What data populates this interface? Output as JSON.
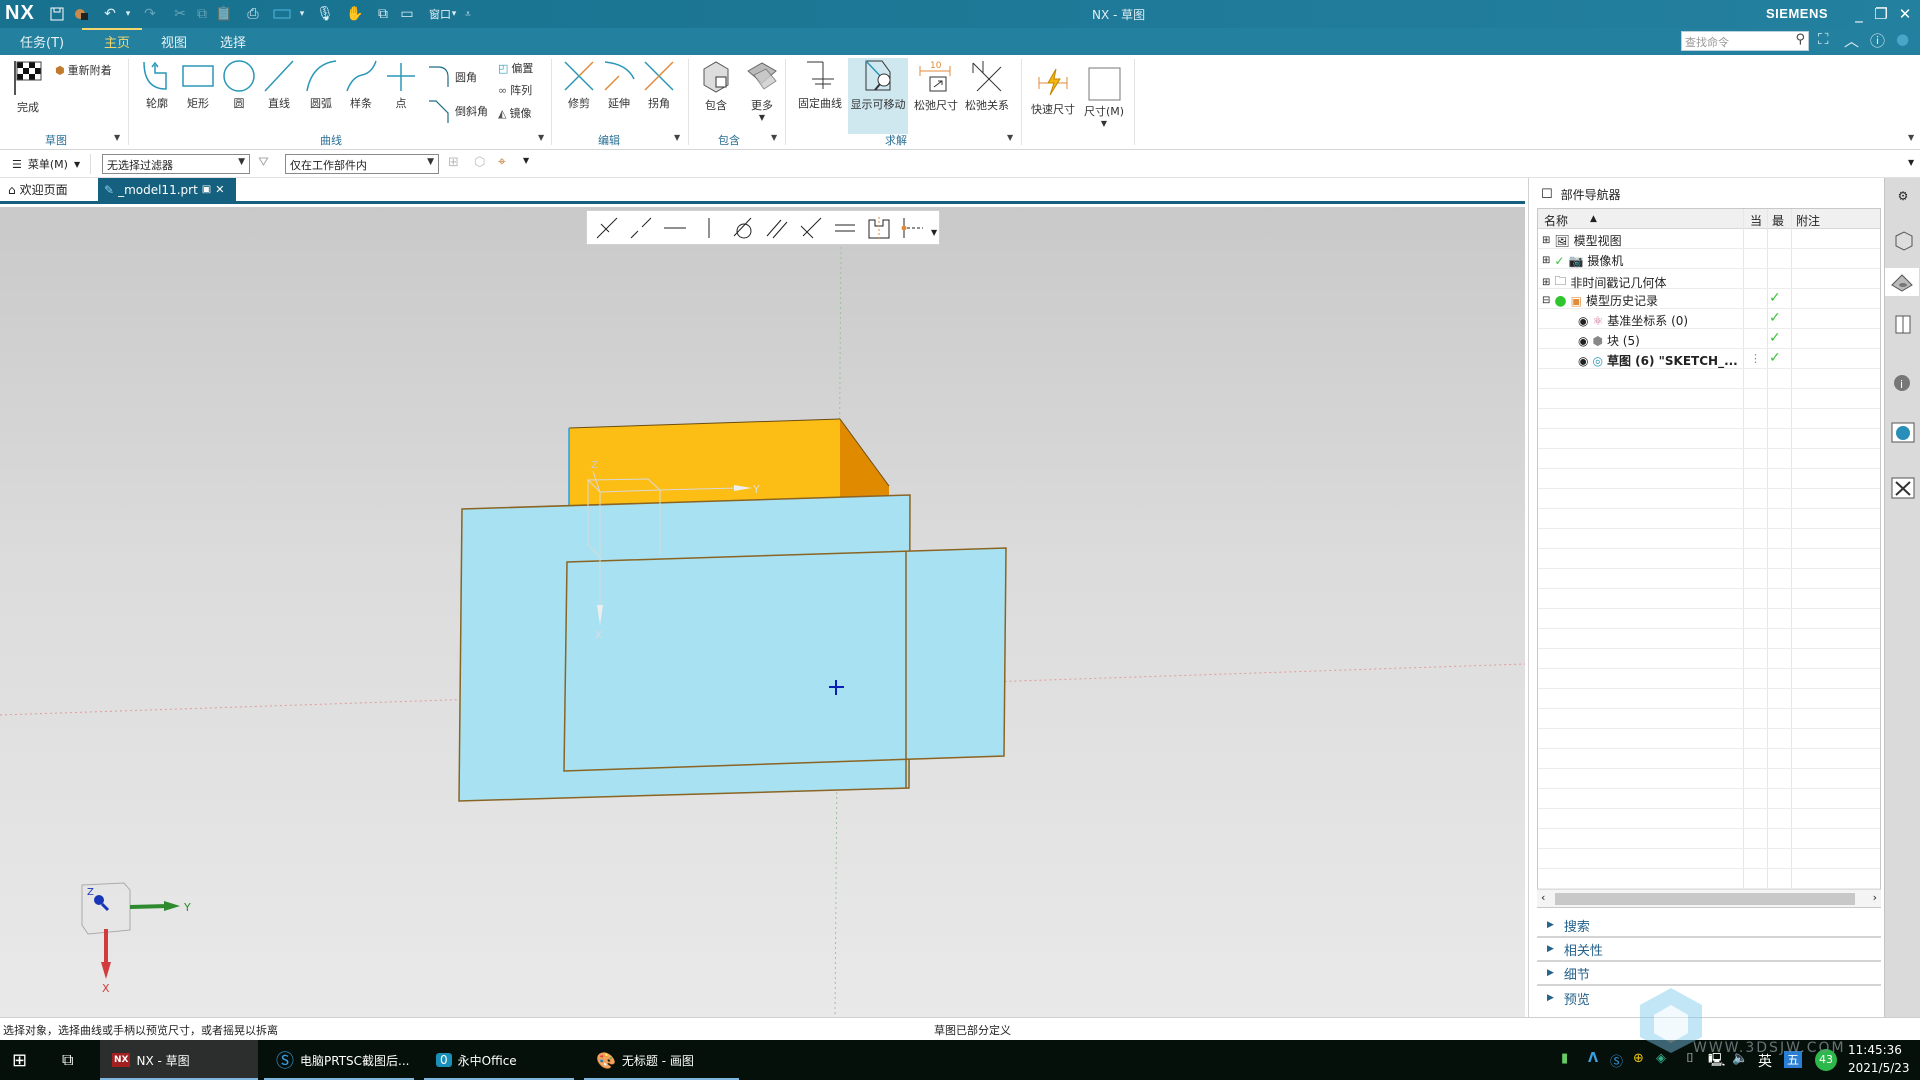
{
  "window": {
    "app_logo": "NX",
    "title": "NX - 草图",
    "brand": "SIEMENS",
    "quick_access": [
      "save-icon",
      "save-all-icon",
      "undo-icon",
      "redo-icon",
      "cut-icon",
      "copy-icon",
      "paste-icon",
      "print-icon",
      "window-shape-icon",
      "microphone-icon",
      "touch-mode-icon",
      "window-cascade-icon",
      "window-icon"
    ],
    "window_menu_label": "窗口"
  },
  "menubar": {
    "tabs": [
      {
        "label": "任务(T)",
        "active": false
      },
      {
        "label": "主页",
        "active": true
      },
      {
        "label": "视图",
        "active": false
      },
      {
        "label": "选择",
        "active": false
      }
    ],
    "search_placeholder": "查找命令"
  },
  "ribbon": {
    "groups": [
      {
        "label": "草图",
        "buttons": [
          {
            "label": "完成",
            "icon": "checkered-flag-icon"
          },
          {
            "label": "重新附着",
            "icon": "reattach-icon"
          }
        ]
      },
      {
        "label": "曲线",
        "buttons": [
          {
            "label": "轮廓",
            "icon": "profile-icon"
          },
          {
            "label": "矩形",
            "icon": "rectangle-icon"
          },
          {
            "label": "圆",
            "icon": "circle-icon"
          },
          {
            "label": "直线",
            "icon": "line-icon"
          },
          {
            "label": "圆弧",
            "icon": "arc-icon"
          },
          {
            "label": "样条",
            "icon": "spline-icon"
          },
          {
            "label": "点",
            "icon": "point-icon"
          },
          {
            "label": "圆角",
            "icon": "fillet-icon"
          },
          {
            "label": "倒斜角",
            "icon": "chamfer-icon"
          },
          {
            "label": "偏置",
            "icon": "offset-icon"
          },
          {
            "label": "阵列",
            "icon": "pattern-icon"
          },
          {
            "label": "镜像",
            "icon": "mirror-icon"
          }
        ]
      },
      {
        "label": "编辑",
        "buttons": [
          {
            "label": "修剪",
            "icon": "trim-icon"
          },
          {
            "label": "延伸",
            "icon": "extend-icon"
          },
          {
            "label": "拐角",
            "icon": "corner-icon"
          }
        ]
      },
      {
        "label": "包含",
        "buttons": [
          {
            "label": "包含",
            "icon": "include-icon"
          },
          {
            "label": "更多",
            "icon": "more-icon"
          }
        ]
      },
      {
        "label": "求解",
        "buttons": [
          {
            "label": "固定曲线",
            "icon": "fix-curve-icon"
          },
          {
            "label": "显示可移动",
            "icon": "show-movable-icon",
            "active": true
          },
          {
            "label": "松弛尺寸",
            "icon": "relax-dimension-icon",
            "dim_value": "10"
          },
          {
            "label": "松弛关系",
            "icon": "relax-relation-icon"
          }
        ]
      },
      {
        "label": "",
        "buttons": [
          {
            "label": "快速尺寸",
            "icon": "rapid-dimension-icon"
          },
          {
            "label": "尺寸(M)",
            "icon": "dimension-icon"
          }
        ]
      }
    ]
  },
  "filterbar": {
    "menu_label": "菜单(M)",
    "type_filter": "无选择过滤器",
    "scope_filter": "仅在工作部件内"
  },
  "doc_tabs": [
    {
      "label": "欢迎页面",
      "active": false
    },
    {
      "label": "_model11.prt",
      "active": true
    }
  ],
  "viewport": {
    "datum_axes": {
      "z": "Z",
      "y": "Y",
      "x": "X"
    },
    "triad": {
      "z": "Z",
      "y": "Y",
      "x": "X"
    },
    "colors": {
      "face_blue": "#a8e1f1",
      "face_orange": "#fcbd14",
      "face_orange_side": "#e08a00",
      "edge": "#8a6423",
      "cursor": "#0c1fb5"
    }
  },
  "part_navigator": {
    "title": "部件导航器",
    "columns": [
      "名称",
      "当",
      "最",
      "附注"
    ],
    "rows": [
      {
        "name": "模型视图",
        "expander": "+",
        "icon": "model-views-icon",
        "latest": false,
        "bold": false
      },
      {
        "name": "摄像机",
        "expander": "+",
        "icon": "camera-icon",
        "latest": false,
        "checked": true,
        "bold": false
      },
      {
        "name": "非时间戳记几何体",
        "expander": "+",
        "icon": "folder-icon",
        "latest": false,
        "bold": false
      },
      {
        "name": "模型历史记录",
        "expander": "−",
        "icon": "history-icon",
        "latest": true,
        "bold": false
      },
      {
        "name": "基准坐标系 (0)",
        "icon": "datum-csys-icon",
        "latest": true,
        "bold": false
      },
      {
        "name": "块 (5)",
        "icon": "block-icon",
        "latest": true,
        "bold": false
      },
      {
        "name": "草图 (6) \"SKETCH_...",
        "icon": "sketch-icon",
        "latest": true,
        "bold": true,
        "current": true
      }
    ],
    "sections": [
      "搜索",
      "相关性",
      "细节",
      "预览"
    ]
  },
  "statusbar": {
    "prompt": "选择对象，选择曲线或手柄以预览尺寸，或者摇晃以拆离",
    "status": "草图已部分定义"
  },
  "taskbar": {
    "apps": [
      {
        "label": "NX - 草图",
        "active": true
      },
      {
        "label": "电脑PRTSC截图后...",
        "active": false
      },
      {
        "label": "永中Office",
        "active": false
      },
      {
        "label": "无标题 - 画图",
        "active": false
      }
    ],
    "tray": {
      "ime_lang": "英",
      "ime_mode": "五",
      "badge": "43",
      "time": "11:45:36",
      "date": "2021/5/23"
    },
    "watermark": "WWW.3DSJW.COM"
  }
}
